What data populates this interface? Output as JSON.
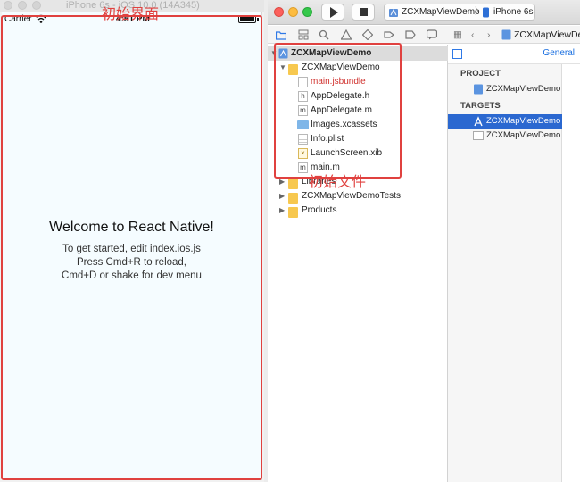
{
  "simulator": {
    "title": "iPhone 6s - iOS 10.0 (14A345)",
    "status": {
      "carrier": "Carrier",
      "time": "4:51 PM"
    },
    "app": {
      "welcome": "Welcome to React Native!",
      "instructions": [
        "To get started, edit index.ios.js",
        "Press Cmd+R to reload,",
        "Cmd+D or shake for dev menu"
      ]
    }
  },
  "annotations": {
    "screen_label": "初始界面",
    "files_label": "初始文件",
    "color": "#e0413f"
  },
  "xcode": {
    "scheme": "ZCXMapViewDemo",
    "device": "iPhone 6s",
    "navigator": {
      "project": "ZCXMapViewDemo",
      "group": "ZCXMapViewDemo",
      "files": [
        {
          "name": "main.jsbundle",
          "missing": true,
          "icon": "file-icon"
        },
        {
          "name": "AppDelegate.h",
          "missing": false,
          "icon": "header-file-icon"
        },
        {
          "name": "AppDelegate.m",
          "missing": false,
          "icon": "source-file-icon"
        },
        {
          "name": "Images.xcassets",
          "missing": false,
          "icon": "asset-catalog-icon"
        },
        {
          "name": "Info.plist",
          "missing": false,
          "icon": "plist-icon"
        },
        {
          "name": "LaunchScreen.xib",
          "missing": false,
          "icon": "xib-icon"
        },
        {
          "name": "main.m",
          "missing": false,
          "icon": "source-file-icon"
        }
      ],
      "other_groups": [
        "Libraries",
        "ZCXMapViewDemoTests",
        "Products"
      ]
    },
    "editor": {
      "jump_title": "ZCXMapViewDemo",
      "general_tab": "General",
      "project_header": "PROJECT",
      "project_item": "ZCXMapViewDemo",
      "targets_header": "TARGETS",
      "targets": [
        "ZCXMapViewDemo",
        "ZCXMapViewDemo..."
      ]
    },
    "colors": {
      "selection": "#2b68d0",
      "missing_file": "#d0312d",
      "folder": "#f7c84f"
    }
  }
}
